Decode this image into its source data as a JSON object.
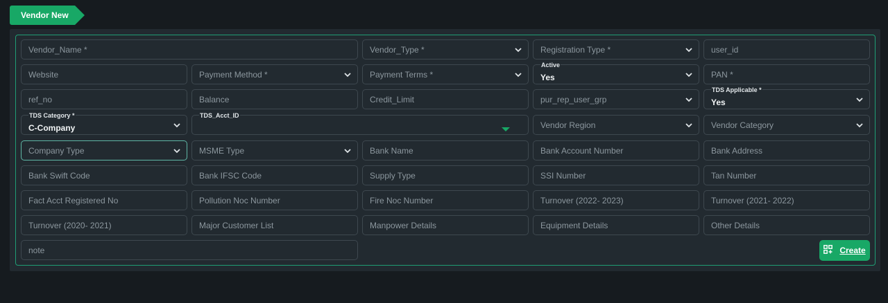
{
  "tab": {
    "label": "Vendor New"
  },
  "fields": {
    "vendor_name": "Vendor_Name *",
    "vendor_type": "Vendor_Type *",
    "registration_type": "Registration Type *",
    "user_id": "user_id",
    "website": "Website",
    "payment_method": "Payment Method *",
    "payment_terms": "Payment Terms *",
    "active_label": "Active",
    "active_value": "Yes",
    "pan": "PAN *",
    "ref_no": "ref_no",
    "balance": "Balance",
    "credit_limit": "Credit_Limit",
    "pur_rep_user_grp": "pur_rep_user_grp",
    "tds_applicable_label": "TDS Applicable *",
    "tds_applicable_value": "Yes",
    "tds_category_label": "TDS Category *",
    "tds_category_value": "C-Company",
    "tds_acct_id_label": "TDS_Acct_ID",
    "vendor_region": "Vendor Region",
    "vendor_category": "Vendor Category",
    "company_type": "Company Type",
    "msme_type": "MSME Type",
    "bank_name": "Bank Name",
    "bank_account_number": "Bank Account Number",
    "bank_address": "Bank Address",
    "bank_swift_code": "Bank Swift Code",
    "bank_ifsc_code": "Bank IFSC Code",
    "supply_type": "Supply Type",
    "ssi_number": "SSI Number",
    "tan_number": "Tan Number",
    "fact_acct_registered_no": "Fact Acct Registered No",
    "pollution_noc_number": "Pollution Noc Number",
    "fire_noc_number": "Fire Noc Number",
    "turnover_2022_2023": "Turnover (2022- 2023)",
    "turnover_2021_2022": "Turnover (2021- 2022)",
    "turnover_2020_2021": "Turnover (2020- 2021)",
    "major_customer_list": "Major Customer List",
    "manpower_details": "Manpower Details",
    "equipment_details": "Equipment Details",
    "other_details": "Other Details",
    "note": "note"
  },
  "actions": {
    "create_label": "Create"
  },
  "colors": {
    "accent": "#18a866",
    "border": "#1f9e74",
    "background": "#161b1f",
    "panel": "#222a30"
  },
  "icons": {
    "dropdown": "chevron-down-icon",
    "autocomplete": "triangle-down-icon",
    "create": "qr-add-icon"
  }
}
